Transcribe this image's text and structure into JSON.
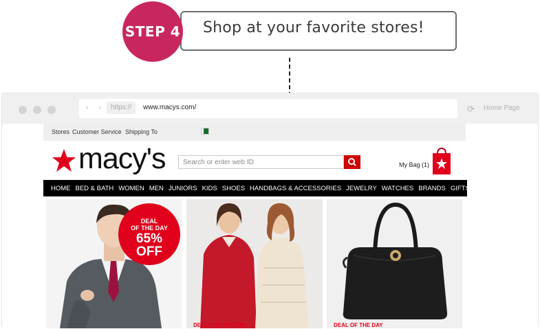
{
  "callout": {
    "step_label": "STEP 4",
    "text": "Shop at your favorite stores!"
  },
  "browser": {
    "protocol": "https://",
    "url": "www.macys.com/",
    "home_label": "Home Page",
    "nav_arrows": "‹ ›",
    "reload_icon": "reload-icon"
  },
  "site": {
    "utility_links": [
      "Stores",
      "Customer Service",
      "Shipping To"
    ],
    "logo_text": "macy's",
    "search_placeholder": "Search or enter web ID",
    "bag_label": "My Bag (1)",
    "nav_items": [
      "HOME",
      "BED & BATH",
      "WOMEN",
      "MEN",
      "JUNIORS",
      "KIDS",
      "SHOES",
      "HANDBAGS & ACCESSORIES",
      "JEWELRY",
      "WATCHES",
      "BRANDS",
      "GIFTS"
    ],
    "tiles": [
      {
        "badge_top": "DEAL\nOF THE DAY",
        "badge_pct": "65%",
        "badge_off": "OFF",
        "caption": ""
      },
      {
        "caption": "DEALS OF THE DAY"
      },
      {
        "caption": "DEAL OF THE DAY"
      }
    ]
  },
  "colors": {
    "step_circle": "#c8265f",
    "macys_red": "#cc0000",
    "nav_bg": "#000000"
  }
}
